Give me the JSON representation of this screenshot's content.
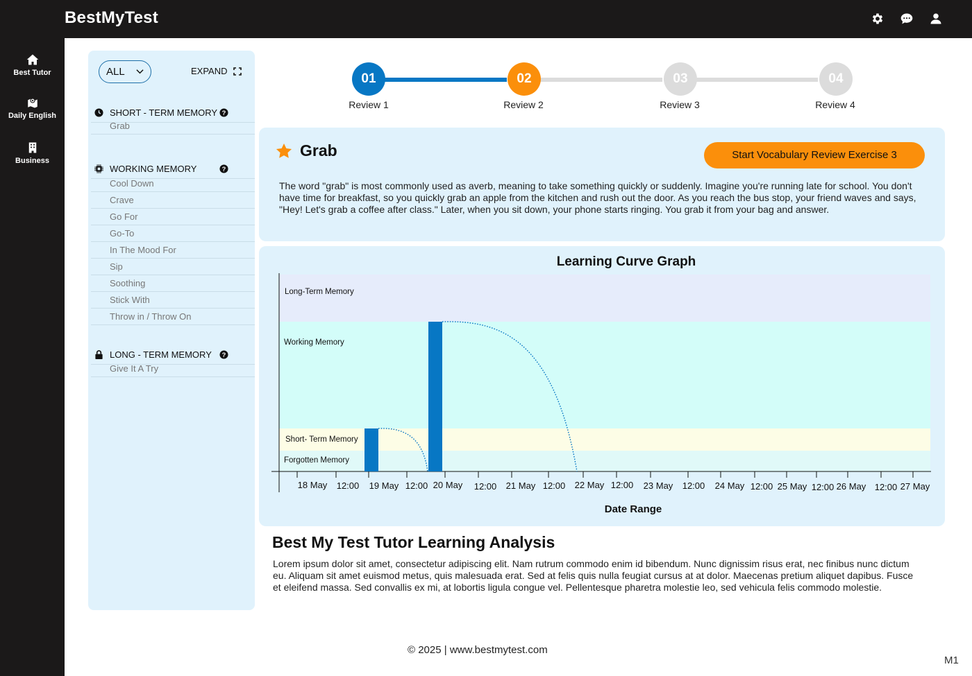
{
  "app": {
    "brand": "BestMyTest"
  },
  "topbar": {
    "icons": [
      "gear-icon",
      "chat-icon",
      "user-icon"
    ]
  },
  "nav": {
    "items": [
      {
        "label": "Best Tutor",
        "icon": "home-icon"
      },
      {
        "label": "Daily English",
        "icon": "map-icon"
      },
      {
        "label": "Business",
        "icon": "building-icon"
      }
    ]
  },
  "panel": {
    "filter": "ALL",
    "expand_label": "EXPAND",
    "sections": [
      {
        "title": "SHORT - TERM MEMORY",
        "icon": "clock-icon",
        "words": [
          "Grab"
        ]
      },
      {
        "title": "WORKING MEMORY",
        "icon": "chip-icon",
        "words": [
          "Cool Down",
          "Crave",
          "Go For",
          "Go-To",
          "In The Mood For",
          "Sip",
          "Soothing",
          "Stick With",
          "Throw in / Throw On"
        ]
      },
      {
        "title": "LONG - TERM MEMORY",
        "icon": "lock-icon",
        "words": [
          "Give It A Try"
        ]
      }
    ]
  },
  "steps": [
    {
      "num": "01",
      "label": "Review 1",
      "color": "#0777c4"
    },
    {
      "num": "02",
      "label": "Review 2",
      "color": "#fb8f0b"
    },
    {
      "num": "03",
      "label": "Review 3",
      "color": "#dcdcdc"
    },
    {
      "num": "04",
      "label": "Review 4",
      "color": "#dcdcdc"
    }
  ],
  "word_card": {
    "word": "Grab",
    "button": "Start Vocabulary Review Exercise 3",
    "description": "The word \"grab\" is most commonly used as averb, meaning to take something quickly or suddenly. Imagine you're running late for school. You don't have time for breakfast, so you quickly grab an apple from the kitchen and rush out the door. As you reach the bus stop, your friend waves and says, \"Hey! Let's grab a coffee after class.\" Later, when you sit down, your phone starts ringing. You grab it from your bag and answer."
  },
  "chart_data": {
    "type": "bar",
    "title": "Learning Curve Graph",
    "xlabel": "Date Range",
    "ylabel": "",
    "x_ticks": [
      "18 May",
      "12:00",
      "19 May",
      "12:00",
      "20 May",
      "12:00",
      "21 May",
      "12:00",
      "22 May",
      "12:00",
      "23 May",
      "12:00",
      "24 May",
      "12:00",
      "25 May",
      "12:00",
      "26 May",
      "12:00",
      "27 May"
    ],
    "bands": [
      {
        "name": "Long-Term Memory",
        "color": "#e6ecfb"
      },
      {
        "name": "Working Memory",
        "color": "#d3fdf9"
      },
      {
        "name": "Short- Term Memory",
        "color": "#fdfde6"
      },
      {
        "name": "Forgotten Memory",
        "color": "#e0f9f8"
      }
    ],
    "bars": [
      {
        "x": "19 May",
        "level": "Short- Term Memory"
      },
      {
        "x": "20 May",
        "level": "Working Memory"
      }
    ],
    "bar_color": "#0777c4",
    "grid": false
  },
  "analysis": {
    "title": "Best My Test Tutor Learning Analysis",
    "body": "Lorem ipsum dolor sit amet, consectetur adipiscing elit. Nam rutrum commodo enim id bibendum. Nunc dignissim risus erat, nec finibus nunc dictum eu. Aliquam sit amet euismod metus, quis malesuada erat. Sed at felis quis nulla feugiat cursus at at dolor. Maecenas pretium aliquet dapibus. Fusce et eleifend massa. Sed convallis ex mi, at lobortis ligula congue vel. Pellentesque pharetra molestie leo, sed vehicula felis commodo molestie."
  },
  "footer": {
    "text": "© 2025 | www.bestmytest.com",
    "corner": "M1"
  }
}
